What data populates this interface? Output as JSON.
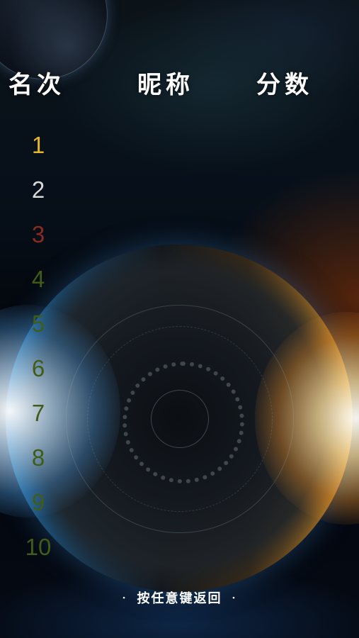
{
  "header": {
    "rank_label": "名次",
    "nickname_label": "昵称",
    "score_label": "分数"
  },
  "ranks": [
    {
      "rank": "1",
      "color": "#e8b52a"
    },
    {
      "rank": "2",
      "color": "#d9d9d9"
    },
    {
      "rank": "3",
      "color": "#8a2b22"
    },
    {
      "rank": "4",
      "color": "#3f5d18"
    },
    {
      "rank": "5",
      "color": "#3f5d18"
    },
    {
      "rank": "6",
      "color": "#3f5d18"
    },
    {
      "rank": "7",
      "color": "#3f5d18"
    },
    {
      "rank": "8",
      "color": "#3f5d18"
    },
    {
      "rank": "9",
      "color": "#3f5d18"
    },
    {
      "rank": "10",
      "color": "#3f5d18"
    }
  ],
  "footer": {
    "hint": "按任意键返回",
    "bullet": "·"
  }
}
